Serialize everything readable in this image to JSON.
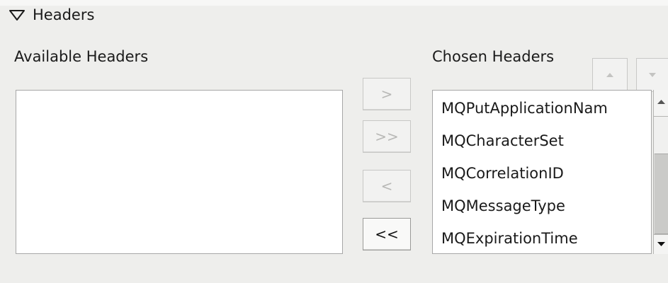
{
  "section": {
    "title": "Headers",
    "expanded": true
  },
  "available": {
    "label": "Available Headers",
    "items": []
  },
  "chosen": {
    "label": "Chosen Headers",
    "items": [
      "MQPutApplicationNam",
      "MQCharacterSet",
      "MQCorrelationID",
      "MQMessageType",
      "MQExpirationTime"
    ]
  },
  "buttons": {
    "add": ">",
    "add_all": ">>",
    "remove": "<",
    "remove_all": "<<"
  },
  "icons": {
    "toggle": "triangle-down-icon",
    "move_up": "arrow-up-icon",
    "move_down": "arrow-down-icon"
  },
  "colors": {
    "background": "#eeeeec",
    "list_background": "#ffffff",
    "disabled_text": "#b8b8b6",
    "enabled_text": "#111111"
  }
}
